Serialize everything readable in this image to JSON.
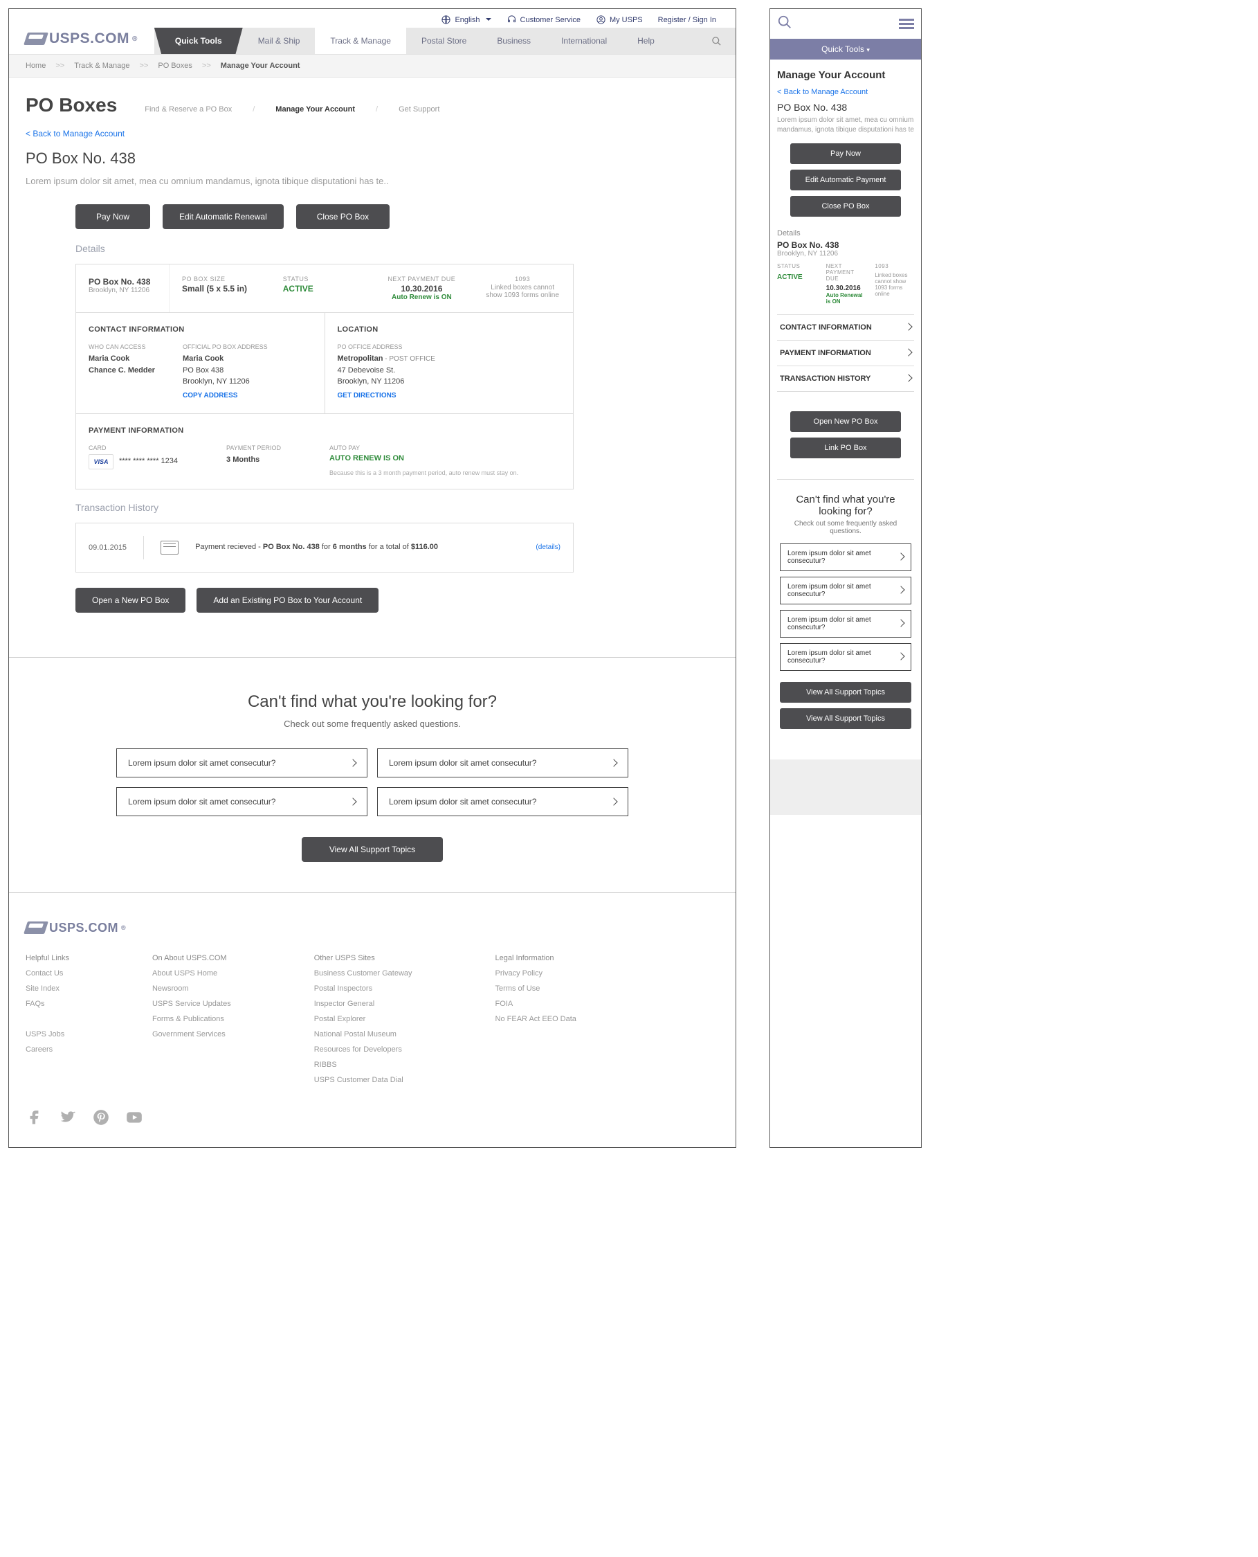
{
  "topUtility": {
    "english": "English",
    "customerService": "Customer Service",
    "myUsps": "My USPS",
    "registerSignIn": "Register  / Sign In"
  },
  "logoText": "USPS.COM",
  "nav": {
    "quickTools": "Quick Tools",
    "mailShip": "Mail & Ship",
    "trackManage": "Track & Manage",
    "postalStore": "Postal Store",
    "business": "Business",
    "international": "International",
    "help": "Help"
  },
  "breadcrumb": {
    "home": "Home",
    "trackManage": "Track & Manage",
    "poBoxes": "PO Boxes",
    "current": "Manage Your Account"
  },
  "page": {
    "title": "PO Boxes",
    "subnav": {
      "findReserve": "Find & Reserve a PO Box",
      "manage": "Manage Your Account",
      "support": "Get Support"
    },
    "backLink": "<  Back to Manage Account",
    "boxTitle": "PO Box No. 438",
    "lead": "Lorem ipsum dolor sit amet, mea cu omnium mandamus, ignota tibique disputationi has te..",
    "buttons": {
      "pay": "Pay Now",
      "editRenewal": "Edit Automatic Renewal",
      "editPayment": "Edit Automatic Payment",
      "close": "Close PO Box"
    },
    "detailsLabel": "Details"
  },
  "details": {
    "boxNo": "PO Box No. 438",
    "boxLoc": "Brooklyn, NY 11206",
    "sizeLabel": "PO BOX SIZE",
    "size": "Small (5 x 5.5 in)",
    "statusLabel": "STATUS",
    "status": "ACTIVE",
    "nextLabel": "NEXT PAYMENT DUE",
    "nextDate": "10.30.2016",
    "autoRenew": "Auto Renew is ON",
    "autoRenewShort": "Auto Renewal is ON",
    "formLabel": "1093",
    "formText": "Linked boxes cannot show 1093 forms online"
  },
  "contact": {
    "heading": "CONTACT INFORMATION",
    "whoLabel": "WHO CAN ACCESS",
    "name1": "Maria Cook",
    "name2": "Chance C. Medder",
    "addrLabel": "OFFICIAL PO BOX ADDRESS",
    "addrName": "Maria Cook",
    "addr1": "PO Box 438",
    "addr2": "Brooklyn, NY 11206",
    "copy": "COPY ADDRESS"
  },
  "location": {
    "heading": "LOCATION",
    "label": "PO OFFICE ADDRESS",
    "name": "Metropolitan",
    "suffix": " - POST OFFICE",
    "addr1": "47 Debevoise St.",
    "addr2": "Brooklyn, NY 11206",
    "directions": "GET DIRECTIONS"
  },
  "payment": {
    "heading": "PAYMENT INFORMATION",
    "cardLabel": "CARD",
    "masked": "**** **** **** 1234",
    "periodLabel": "PAYMENT PERIOD",
    "period": "3 Months",
    "autoLabel": "AUTO PAY",
    "autoOn": "AUTO RENEW IS ON",
    "note": "Because this is a 3 month payment period, auto renew must stay on."
  },
  "txn": {
    "heading": "Transaction History",
    "date": "09.01.2015",
    "textPre": "Payment recieved - ",
    "textBox": "PO Box No. 438",
    "textMid": " for ",
    "textPeriod": "6 months",
    "textMid2": " for a total of ",
    "textAmt": "$116.00",
    "details": "(details)"
  },
  "afterButtons": {
    "openNew": "Open a New PO Box",
    "openNewShort": "Open New PO Box",
    "addExisting": "Add an Existing PO Box to Your Account",
    "link": "Link PO Box"
  },
  "faq": {
    "title": "Can't find what you're looking for?",
    "sub": "Check out some frequently asked questions.",
    "q": "Lorem ipsum dolor sit amet consecutur?",
    "viewAll": "View All Support Topics"
  },
  "mobileAcc": {
    "contact": "CONTACT INFORMATION",
    "payment": "PAYMENT INFORMATION",
    "txn": "TRANSACTION HISTORY"
  },
  "footer": {
    "col1h": "Helpful Links",
    "col1": [
      "Contact Us",
      "Site Index",
      "FAQs",
      "",
      "USPS Jobs",
      "Careers"
    ],
    "col2h": "On About USPS.COM",
    "col2": [
      "About USPS Home",
      "Newsroom",
      "USPS Service Updates",
      "Forms & Publications",
      "Government Services"
    ],
    "col3h": "Other USPS Sites",
    "col3": [
      "Business Customer Gateway",
      "Postal Inspectors",
      "Inspector General",
      "Postal Explorer",
      "National Postal Museum",
      "Resources for Developers",
      "RIBBS",
      "USPS Customer Data Dial"
    ],
    "col4h": "Legal Information",
    "col4": [
      "Privacy Policy",
      "Terms of Use",
      "FOIA",
      "No FEAR Act EEO Data"
    ]
  }
}
